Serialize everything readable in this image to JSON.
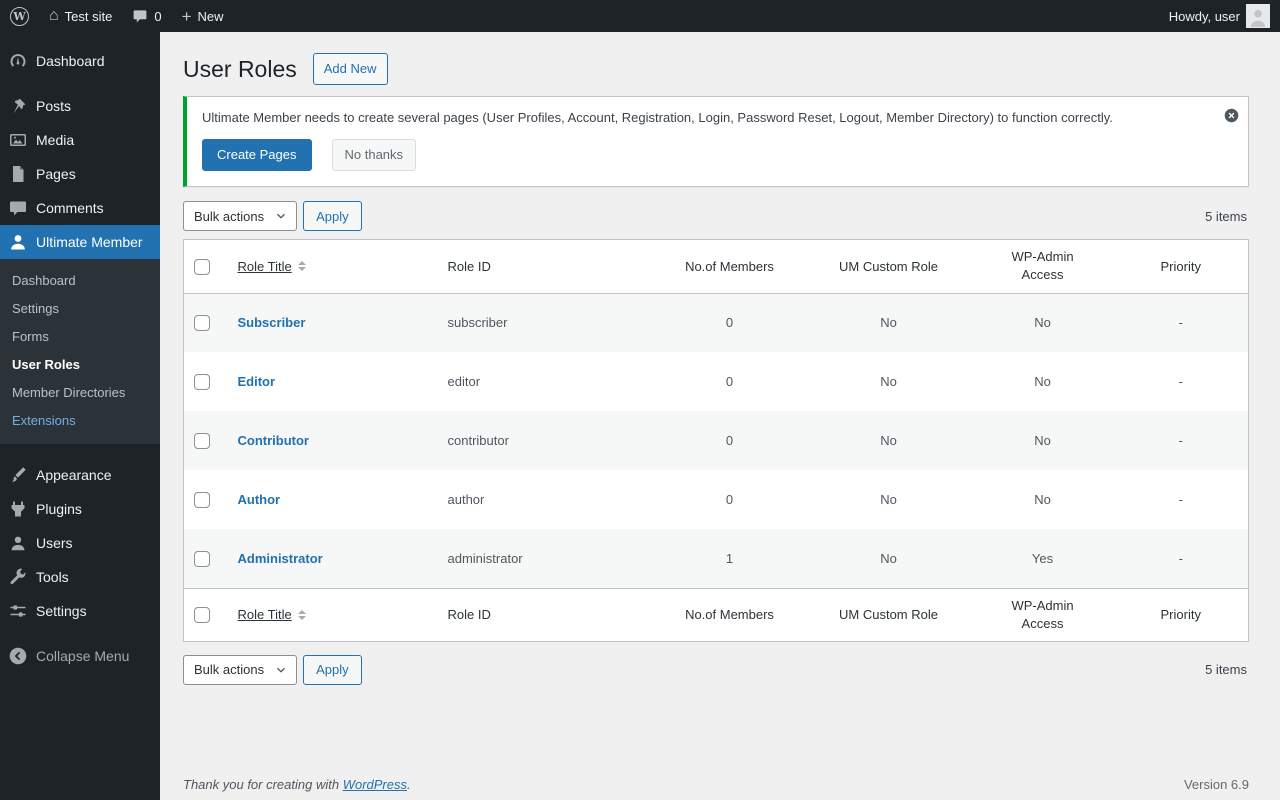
{
  "admin_bar": {
    "site_name": "Test site",
    "comments_count": "0",
    "new_label": "New",
    "howdy_text": "Howdy, user"
  },
  "sidebar": {
    "items": [
      {
        "label": "Dashboard"
      },
      {
        "label": "Posts"
      },
      {
        "label": "Media"
      },
      {
        "label": "Pages"
      },
      {
        "label": "Comments"
      },
      {
        "label": "Ultimate Member"
      },
      {
        "label": "Appearance"
      },
      {
        "label": "Plugins"
      },
      {
        "label": "Users"
      },
      {
        "label": "Tools"
      },
      {
        "label": "Settings"
      },
      {
        "label": "Collapse Menu"
      }
    ],
    "um_submenu": [
      {
        "label": "Dashboard"
      },
      {
        "label": "Settings"
      },
      {
        "label": "Forms"
      },
      {
        "label": "User Roles"
      },
      {
        "label": "Member Directories"
      },
      {
        "label": "Extensions"
      }
    ]
  },
  "page": {
    "title": "User Roles",
    "add_new_label": "Add New"
  },
  "notice": {
    "message": "Ultimate Member needs to create several pages (User Profiles, Account, Registration, Login, Password Reset, Logout, Member Directory) to function correctly.",
    "create_pages_label": "Create Pages",
    "no_thanks_label": "No thanks"
  },
  "tablenav": {
    "bulk_actions_label": "Bulk actions",
    "apply_label": "Apply",
    "items_count": "5 items"
  },
  "table": {
    "headers": {
      "role_title": "Role Title",
      "role_id": "Role ID",
      "members": "No.of Members",
      "custom_role": "UM Custom Role",
      "wp_admin_access": "WP-Admin Access",
      "priority": "Priority"
    },
    "rows": [
      {
        "title": "Subscriber",
        "role_id": "subscriber",
        "members": "0",
        "custom_role": "No",
        "wp_admin_access": "No",
        "priority": "-"
      },
      {
        "title": "Editor",
        "role_id": "editor",
        "members": "0",
        "custom_role": "No",
        "wp_admin_access": "No",
        "priority": "-"
      },
      {
        "title": "Contributor",
        "role_id": "contributor",
        "members": "0",
        "custom_role": "No",
        "wp_admin_access": "No",
        "priority": "-"
      },
      {
        "title": "Author",
        "role_id": "author",
        "members": "0",
        "custom_role": "No",
        "wp_admin_access": "No",
        "priority": "-"
      },
      {
        "title": "Administrator",
        "role_id": "administrator",
        "members": "1",
        "custom_role": "No",
        "wp_admin_access": "Yes",
        "priority": "-"
      }
    ]
  },
  "footer": {
    "thanks_prefix": "Thank you for creating with",
    "wordpress_link": "WordPress",
    "period": ".",
    "version": "Version 6.9"
  },
  "colors": {
    "accent_blue": "#2271b1",
    "notice_green": "#00a32a",
    "admin_bar_bg": "#1d2327",
    "content_bg": "#f0f0f1"
  }
}
